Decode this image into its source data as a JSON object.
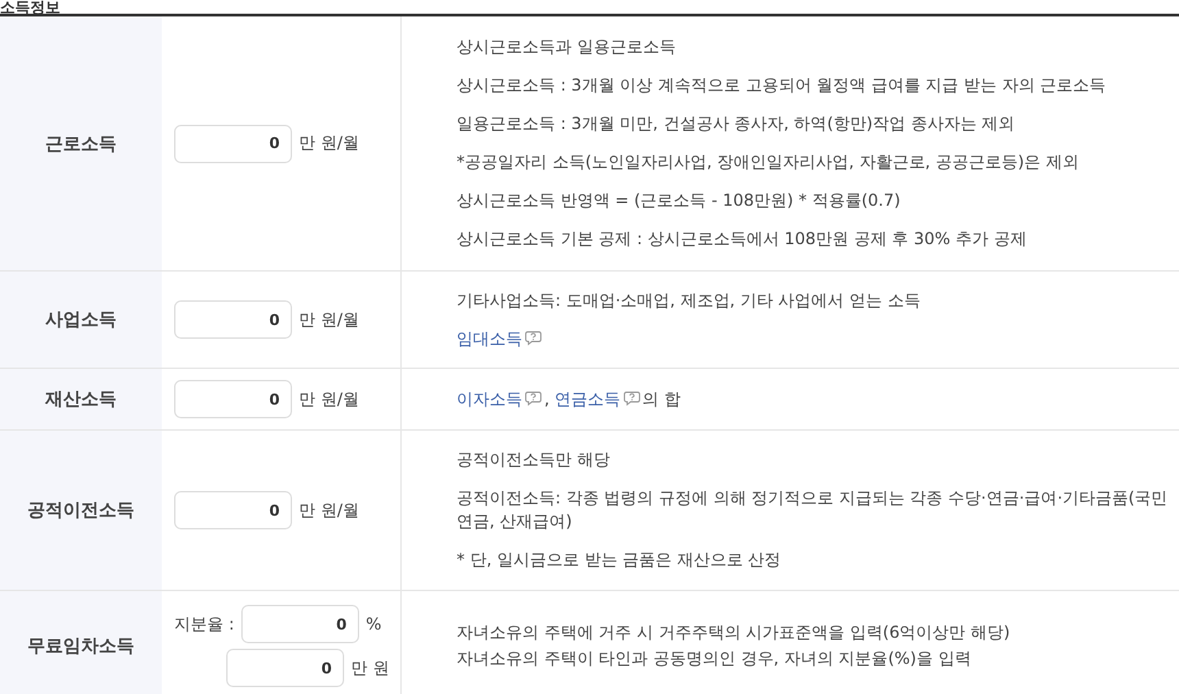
{
  "section_title": "소득정보",
  "rows": [
    {
      "label": "근로소득",
      "kind": "spaced",
      "fields": [
        {
          "value": "0",
          "unit": "만 원/월"
        }
      ],
      "lines": [
        [
          {
            "kind": "text",
            "text": "상시근로소득과 일용근로소득"
          }
        ],
        [
          {
            "kind": "text",
            "text": "상시근로소득 : 3개월 이상 계속적으로 고용되어 월정액 급여를 지급 받는 자의 근로소득"
          }
        ],
        [
          {
            "kind": "text",
            "text": "일용근로소득 : 3개월 미만, 건설공사 종사자, 하역(항만)작업 종사자는 제외"
          }
        ],
        [
          {
            "kind": "text",
            "text": "*공공일자리 소득(노인일자리사업, 장애인일자리사업, 자활근로, 공공근로등)은 제외"
          }
        ],
        [
          {
            "kind": "text",
            "text": "상시근로소득 반영액 = (근로소득 - 108만원) * 적용률(0.7)"
          }
        ],
        [
          {
            "kind": "text",
            "text": "상시근로소득 기본 공제 : 상시근로소득에서 108만원 공제 후 30% 추가 공제"
          }
        ]
      ]
    },
    {
      "label": "사업소득",
      "kind": "spaced",
      "fields": [
        {
          "value": "0",
          "unit": "만 원/월"
        }
      ],
      "lines": [
        [
          {
            "kind": "text",
            "text": "기타사업소득: 도매업·소매업, 제조업, 기타 사업에서 얻는 소득"
          }
        ],
        [
          {
            "kind": "link",
            "text": "임대소득"
          }
        ]
      ]
    },
    {
      "label": "재산소득",
      "kind": "spaced",
      "fields": [
        {
          "value": "0",
          "unit": "만 원/월"
        }
      ],
      "lines": [
        [
          {
            "kind": "link",
            "text": "이자소득"
          },
          {
            "kind": "text",
            "text": ", "
          },
          {
            "kind": "link",
            "text": "연금소득"
          },
          {
            "kind": "text",
            "text": "의 합"
          }
        ]
      ]
    },
    {
      "label": "공적이전소득",
      "kind": "spaced",
      "fields": [
        {
          "value": "0",
          "unit": "만 원/월"
        }
      ],
      "lines": [
        [
          {
            "kind": "text",
            "text": "공적이전소득만 해당"
          }
        ],
        [
          {
            "kind": "text",
            "text": "공적이전소득: 각종 법령의 규정에 의해 정기적으로 지급되는 각종 수당·연금·급여·기타금품(국민연금, 산재급여)"
          }
        ],
        [
          {
            "kind": "text",
            "text": "* 단, 일시금으로 받는 금품은 재산으로 산정"
          }
        ]
      ]
    },
    {
      "label": "무료임차소득",
      "kind": "dense",
      "fields": [
        {
          "prefix": "지분율 :",
          "value": "0",
          "unit": "%"
        },
        {
          "value": "0",
          "unit": "만 원"
        }
      ],
      "lines": [
        [
          {
            "kind": "text",
            "text": "자녀소유의 주택에 거주 시 거주주택의 시가표준액을 입력(6억이상만 해당)"
          }
        ],
        [
          {
            "kind": "text",
            "text": "자녀소유의 주택이 타인과 공동명의인 경우, 자녀의 지분율(%)을 입력"
          }
        ]
      ]
    }
  ]
}
